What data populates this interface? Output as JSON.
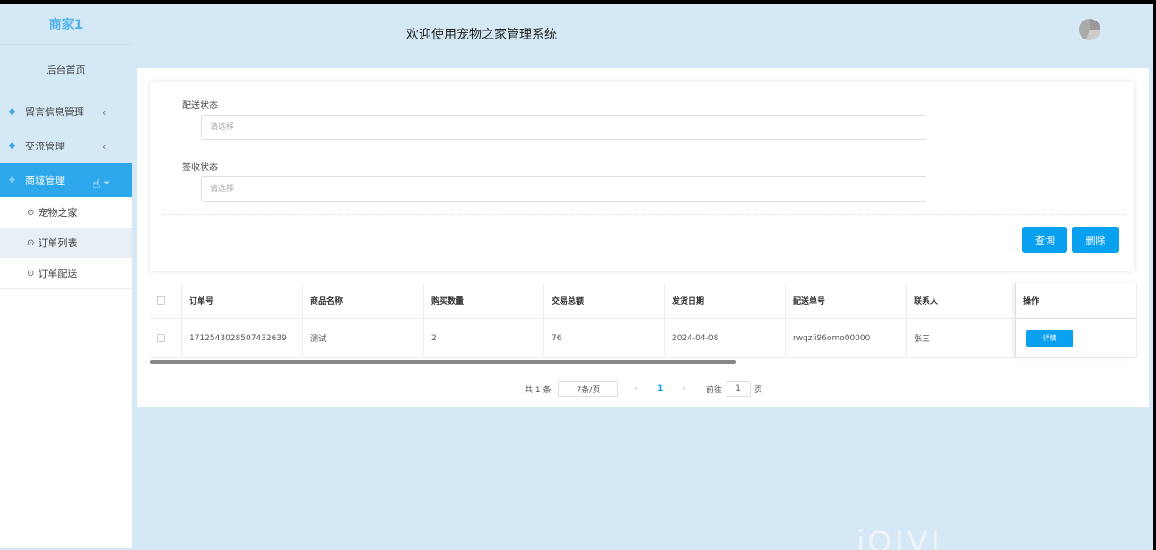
{
  "sidebar": {
    "brand": "商家1",
    "home": "后台首页",
    "menus": [
      {
        "label": "留言信息管理",
        "chevron": "‹"
      },
      {
        "label": "交流管理",
        "chevron": "‹"
      },
      {
        "label": "商城管理",
        "chevron": "⌄"
      }
    ],
    "submenu": [
      "宠物之家",
      "订单列表",
      "订单配送"
    ]
  },
  "header": {
    "title": "欢迎使用宠物之家管理系统"
  },
  "filters": {
    "delivery_label": "配送状态",
    "delivery_placeholder": "请选择",
    "sign_label": "签收状态",
    "sign_placeholder": "请选择",
    "query_button": "查询",
    "delete_button": "删除"
  },
  "table": {
    "columns": [
      "订单号",
      "商品名称",
      "购买数量",
      "交易总额",
      "发货日期",
      "配送单号",
      "联系人",
      "操作"
    ],
    "rows": [
      {
        "order_no": "1712543028507432639",
        "product": "测试",
        "qty": "2",
        "total": "76",
        "ship_date": "2024-04-08",
        "tracking": "rwqzli96omo00000",
        "contact": "张三",
        "action": "详情"
      }
    ]
  },
  "pagination": {
    "total": "共 1 条",
    "page_size": "7条/页",
    "prev": "‹",
    "current": "1",
    "next": "›",
    "goto": "前往",
    "goto_value": "1",
    "page_suffix": "页"
  },
  "watermark": "iOIVI"
}
